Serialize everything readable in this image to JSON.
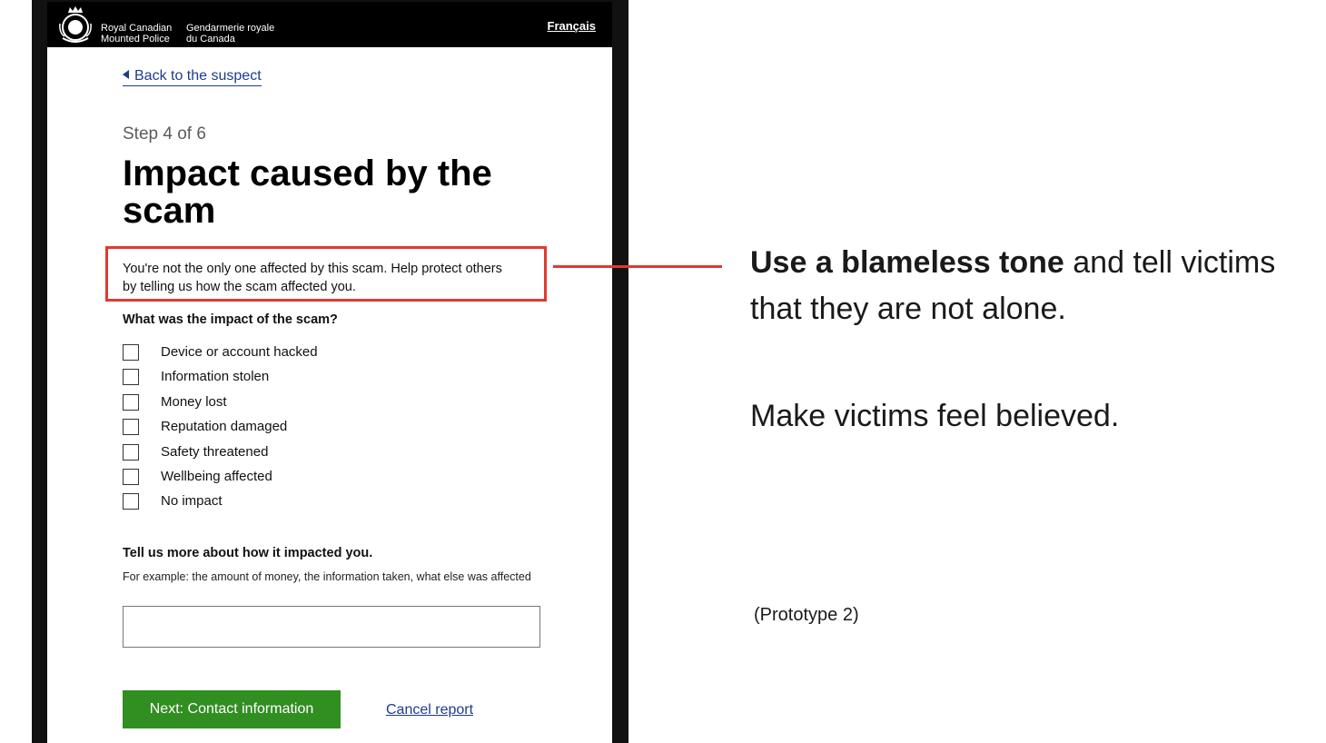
{
  "header": {
    "org_en": [
      "Royal Canadian",
      "Mounted Police"
    ],
    "org_fr": [
      "Gendarmerie royale",
      "du Canada"
    ],
    "language_link": "Français"
  },
  "form": {
    "back_link": "Back to the suspect",
    "step": "Step 4 of 6",
    "title": "Impact caused by the scam",
    "intro": "You're not the only one affected by this scam. Help protect others by telling us how the scam affected you.",
    "question": "What was the impact of the scam?",
    "options": [
      "Device or account hacked",
      "Information stolen",
      "Money lost",
      "Reputation damaged",
      "Safety threatened",
      "Wellbeing affected",
      "No impact"
    ],
    "more_label": "Tell us more about how it impacted you.",
    "more_hint": "For example: the amount of money, the information taken, what else was affected",
    "more_value": "",
    "next_button": "Next: Contact information",
    "cancel_link": "Cancel report"
  },
  "annotations": {
    "note1_bold": "Use a blameless tone",
    "note1_rest": " and tell victims that they are not alone.",
    "note2": "Make victims feel believed.",
    "note3": "(Prototype 2)"
  },
  "colors": {
    "highlight": "#e03a2f",
    "button": "#318e21",
    "link": "#1c3d8c"
  },
  "icons": {
    "crest": "rcmp-crest-icon",
    "back": "back-arrow-icon",
    "resize": "resize-grip-icon"
  }
}
